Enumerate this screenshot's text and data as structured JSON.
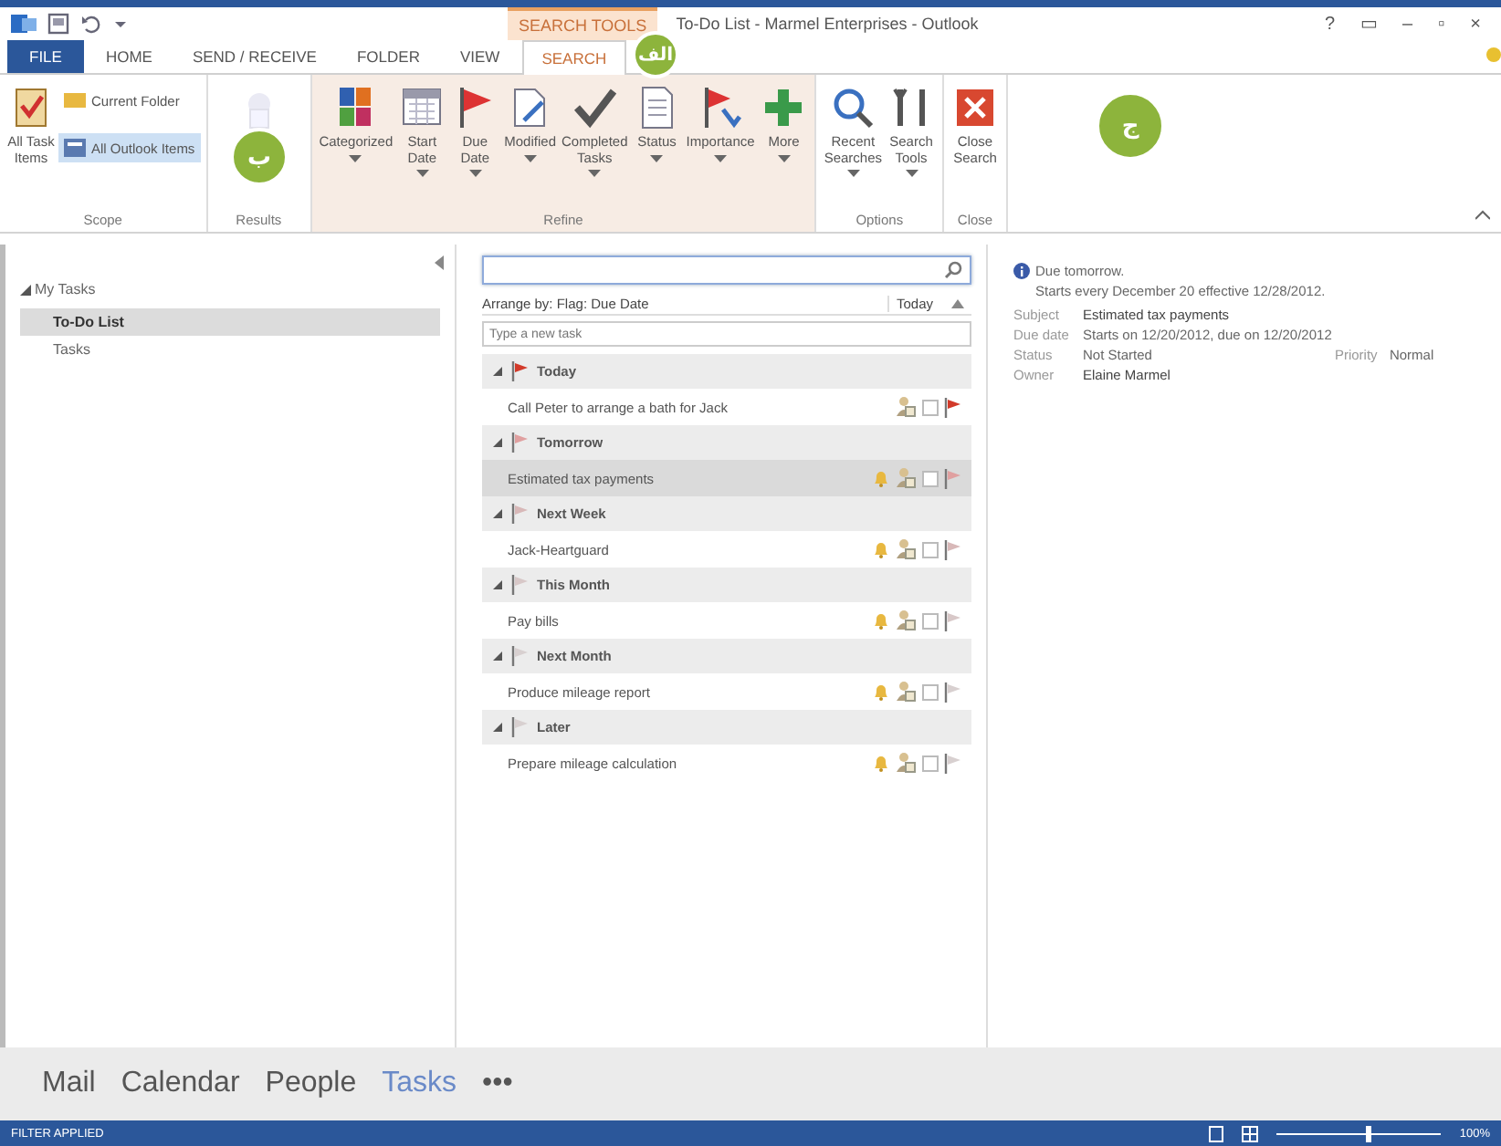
{
  "window": {
    "context_label": "SEARCH TOOLS",
    "title": "To-Do List - Marmel Enterprises - Outlook",
    "controls": [
      "?",
      "▭",
      "–",
      "▫",
      "×"
    ]
  },
  "tabs": [
    {
      "label": "FILE",
      "selected": false,
      "kind": "file"
    },
    {
      "label": "HOME",
      "selected": false,
      "kind": "tab"
    },
    {
      "label": "SEND / RECEIVE",
      "selected": false,
      "kind": "tab"
    },
    {
      "label": "FOLDER",
      "selected": false,
      "kind": "tab"
    },
    {
      "label": "VIEW",
      "selected": false,
      "kind": "tab"
    },
    {
      "label": "SEARCH",
      "selected": true,
      "kind": "context"
    }
  ],
  "ribbon": [
    {
      "label": "Scope",
      "kind": "scope",
      "items": [
        {
          "label": "All Task\nItems",
          "kind": "large",
          "selected": false
        },
        {
          "label": "Current Folder",
          "kind": "small",
          "selected": false
        },
        {
          "label": "All Outlook Items",
          "kind": "small",
          "selected": true
        }
      ]
    },
    {
      "label": "Results",
      "kind": "plain",
      "items": [
        {
          "kind": "faded",
          "selected": false
        }
      ]
    },
    {
      "label": "Refine",
      "kind": "tinted",
      "items": [
        {
          "label": "Categorized",
          "kind": "large",
          "dropdown": true,
          "selected": false
        },
        {
          "label": "Start\nDate",
          "kind": "large",
          "dropdown": true,
          "selected": false
        },
        {
          "label": "Due\nDate",
          "kind": "large",
          "dropdown": true,
          "selected": false
        },
        {
          "label": "Modified",
          "kind": "large",
          "dropdown": true,
          "selected": false
        },
        {
          "label": "Completed\nTasks",
          "kind": "large",
          "dropdown": true,
          "selected": false
        },
        {
          "label": "Status",
          "kind": "large",
          "dropdown": true,
          "selected": false
        },
        {
          "label": "Importance",
          "kind": "large",
          "dropdown": true,
          "selected": false
        },
        {
          "label": "More",
          "kind": "large",
          "dropdown": true,
          "selected": false
        }
      ]
    },
    {
      "label": "Options",
      "kind": "plain",
      "items": [
        {
          "label": "Recent\nSearches",
          "kind": "large",
          "dropdown": true,
          "selected": false
        },
        {
          "label": "Search\nTools",
          "kind": "large",
          "dropdown": true,
          "selected": false
        }
      ]
    },
    {
      "label": "Close",
      "kind": "plain",
      "items": [
        {
          "label": "Close\nSearch",
          "kind": "large",
          "selected": false
        }
      ]
    }
  ],
  "folders": {
    "label": "My Tasks",
    "expanded": true,
    "children": [
      {
        "label": "To-Do List",
        "selected": true
      },
      {
        "label": "Tasks",
        "selected": false
      }
    ]
  },
  "task_list": {
    "arrange_by": "Arrange by: Flag: Due Date",
    "sort": "Today",
    "new_task_placeholder": "Type a new task",
    "groups": [
      {
        "name": "Today",
        "color": "#d23a2a",
        "tasks": [
          {
            "title": "Call Peter to arrange a bath for Jack",
            "reminder": false,
            "selected": false,
            "color": "#d23a2a"
          }
        ]
      },
      {
        "name": "Tomorrow",
        "color": "#e0a0a0",
        "tasks": [
          {
            "title": "Estimated tax payments",
            "reminder": true,
            "selected": true,
            "color": "#e0a0a0"
          }
        ]
      },
      {
        "name": "Next Week",
        "color": "#d8b8b8",
        "tasks": [
          {
            "title": "Jack-Heartguard",
            "reminder": true,
            "selected": false,
            "color": "#d8b8b8"
          }
        ]
      },
      {
        "name": "This Month",
        "color": "#d8c8c8",
        "tasks": [
          {
            "title": "Pay bills",
            "reminder": true,
            "selected": false,
            "color": "#d8c8c8"
          }
        ]
      },
      {
        "name": "Next Month",
        "color": "#d8d0d0",
        "tasks": [
          {
            "title": "Produce mileage report",
            "reminder": true,
            "selected": false,
            "color": "#d8d0d0"
          }
        ]
      },
      {
        "name": "Later",
        "color": "#d8d0d0",
        "tasks": [
          {
            "title": "Prepare mileage calculation",
            "reminder": true,
            "selected": false,
            "color": "#d8d0d0"
          }
        ]
      }
    ]
  },
  "reading_pane": {
    "notice": "Due tomorrow.",
    "recurrence": "Starts every December 20 effective 12/28/2012.",
    "fields": [
      {
        "label": "Subject",
        "value": "Estimated tax payments"
      },
      {
        "label": "Due date",
        "value": "Starts on 12/20/2012, due on 12/20/2012"
      },
      {
        "label": "Status",
        "value": "Not Started"
      },
      {
        "label": "Owner",
        "value": "Elaine Marmel"
      }
    ],
    "priority_label": "Priority",
    "priority": "Normal"
  },
  "nav": [
    {
      "label": "Mail",
      "selected": false
    },
    {
      "label": "Calendar",
      "selected": false
    },
    {
      "label": "People",
      "selected": false
    },
    {
      "label": "Tasks",
      "selected": true
    },
    {
      "label": "•••",
      "selected": false
    }
  ],
  "status_bar": {
    "text": "FILTER APPLIED",
    "zoom": "100%",
    "zoom_slider": {
      "level": 0.55
    }
  },
  "callouts": [
    {
      "label": "الف"
    },
    {
      "label": "ب"
    },
    {
      "label": "ج"
    }
  ]
}
